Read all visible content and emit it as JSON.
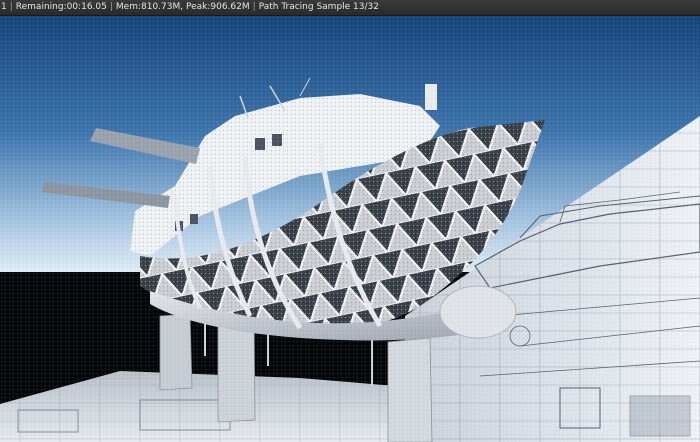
{
  "render_header": {
    "frame": "1",
    "remaining": "Remaining:00:16.05",
    "memory": "Mem:810.73M, Peak:906.62M",
    "sample_status": "Path Tracing Sample 13/32",
    "separator": "|"
  },
  "colors": {
    "header_bg": "#2b2b2b",
    "header_text": "#e6e6e6",
    "sky_top": "#1f4f86",
    "sky_bottom": "#d8e6f2",
    "ground_dark": "#05070a",
    "blueprint_paper": "#dde3ea",
    "hull_frames": "#d2d4d8",
    "hull_shadow": "#2a2f36"
  },
  "viewport": {
    "scene": "ship-hull-3d-render",
    "icons": [
      "render-view-icon"
    ]
  }
}
